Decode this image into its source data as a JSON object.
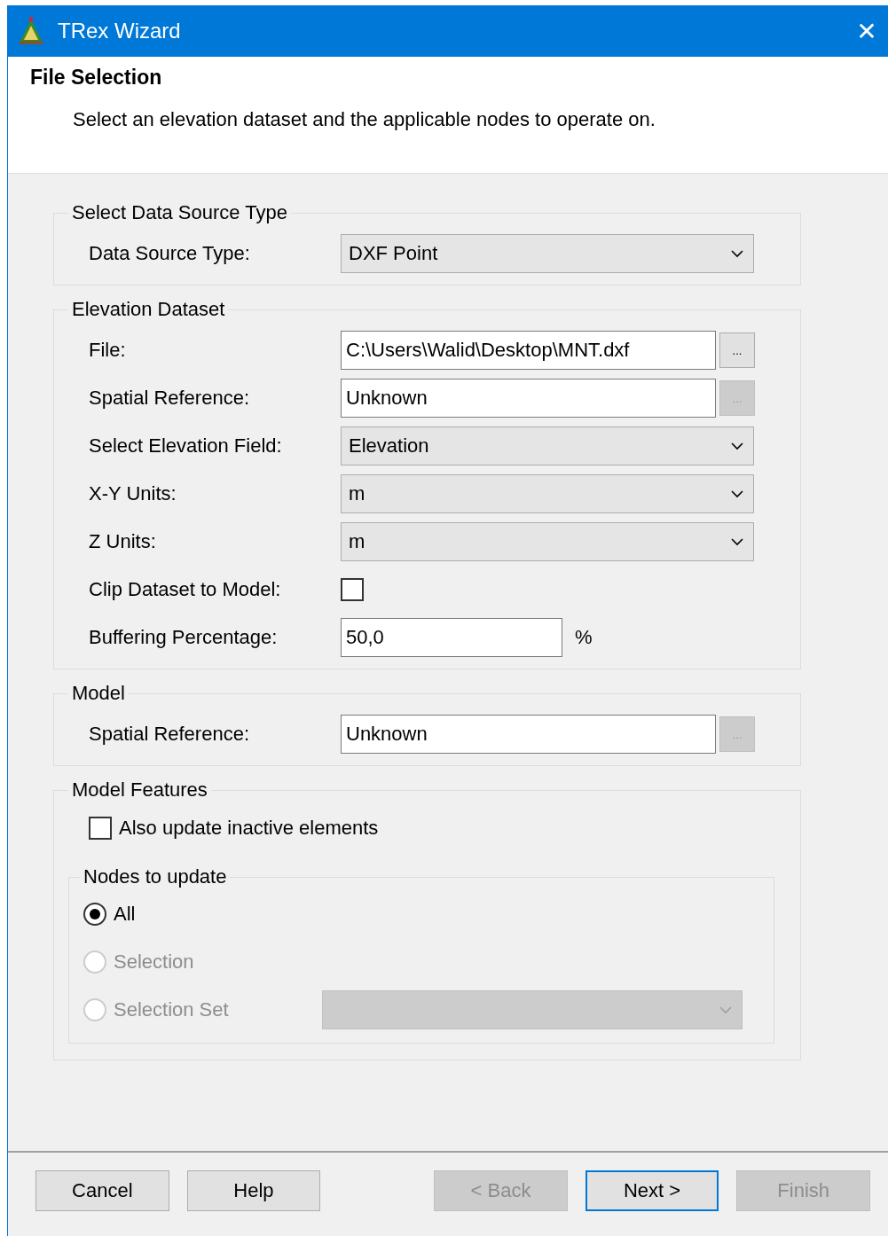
{
  "window": {
    "title": "TRex Wizard",
    "close": "✕"
  },
  "header": {
    "title": "File Selection",
    "description": "Select an elevation dataset and the applicable nodes to operate on."
  },
  "groups": [
    {
      "title": "Select Data Source Type",
      "rows": [
        {
          "kind": "dropdown",
          "label": "Data Source Type:",
          "value": "DXF Point"
        }
      ]
    },
    {
      "title": "Elevation Dataset",
      "rows": [
        {
          "kind": "path",
          "label": "File:",
          "value": "C:\\Users\\Walid\\Desktop\\MNT.dxf",
          "browse": "...",
          "browse_disabled": false
        },
        {
          "kind": "path",
          "label": "Spatial Reference:",
          "value": "Unknown",
          "browse": "...",
          "browse_disabled": true
        },
        {
          "kind": "dropdown",
          "label": "Select Elevation Field:",
          "value": "Elevation"
        },
        {
          "kind": "dropdown",
          "label": "X-Y Units:",
          "value": "m"
        },
        {
          "kind": "dropdown",
          "label": "Z Units:",
          "value": "m"
        },
        {
          "kind": "checkbox",
          "label": "Clip Dataset to Model:",
          "checked": false
        },
        {
          "kind": "number",
          "label": "Buffering Percentage:",
          "value": "50,0",
          "unit": "%"
        }
      ]
    },
    {
      "title": "Model",
      "rows": [
        {
          "kind": "path",
          "label": "Spatial Reference:",
          "value": "Unknown",
          "browse": "...",
          "browse_disabled": true
        }
      ]
    },
    {
      "title": "Model Features",
      "rows": [
        {
          "kind": "check",
          "label": "Also update inactive elements",
          "checked": false
        },
        {
          "kind": "subgroup",
          "title": "Nodes to update",
          "options": [
            {
              "label": "All",
              "selected": true,
              "disabled": false
            },
            {
              "label": "Selection",
              "selected": false,
              "disabled": true
            },
            {
              "label": "Selection Set",
              "selected": false,
              "disabled": true,
              "dropdown_disabled": true
            }
          ]
        }
      ]
    }
  ],
  "buttons": [
    {
      "label": "Cancel",
      "disabled": false,
      "default": false
    },
    {
      "label": "Help",
      "disabled": false,
      "default": false
    },
    {
      "label": "< Back",
      "disabled": true,
      "default": false
    },
    {
      "label": "Next >",
      "disabled": false,
      "default": true
    },
    {
      "label": "Finish",
      "disabled": true,
      "default": false
    }
  ]
}
